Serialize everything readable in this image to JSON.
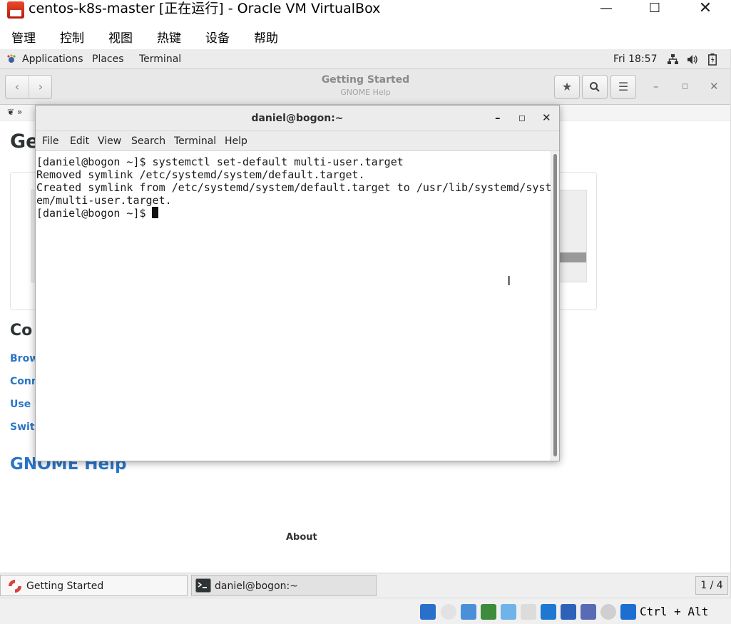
{
  "host": {
    "title": "centos-k8s-master [正在运行] - Oracle VM VirtualBox",
    "menu": [
      "管理",
      "控制",
      "视图",
      "热键",
      "设备",
      "帮助"
    ],
    "status": {
      "host_key": "Ctrl + Alt"
    }
  },
  "gnome_panel": {
    "applications": "Applications",
    "places": "Places",
    "terminal": "Terminal",
    "clock": "Fri 18:57"
  },
  "help_window": {
    "title": "Getting Started",
    "subtitle": "GNOME Help",
    "page_heading": "Ge",
    "section_heading": "Co",
    "links": [
      "Brows",
      "Conne",
      "Use w",
      "Switc"
    ],
    "gnome_help_link": "GNOME Help",
    "about": "About"
  },
  "terminal": {
    "title": "daniel@bogon:~",
    "menu": [
      "File",
      "Edit",
      "View",
      "Search",
      "Terminal",
      "Help"
    ],
    "lines": [
      "[daniel@bogon ~]$ systemctl set-default multi-user.target",
      "Removed symlink /etc/systemd/system/default.target.",
      "Created symlink from /etc/systemd/system/default.target to /usr/lib/systemd/syst",
      "em/multi-user.target.",
      "[daniel@bogon ~]$ "
    ]
  },
  "taskbar": {
    "tasks": [
      {
        "label": "Getting Started",
        "icon": "lifebuoy-icon"
      },
      {
        "label": "daniel@bogon:~",
        "icon": "terminal-icon"
      }
    ],
    "workspace": "1 / 4"
  }
}
